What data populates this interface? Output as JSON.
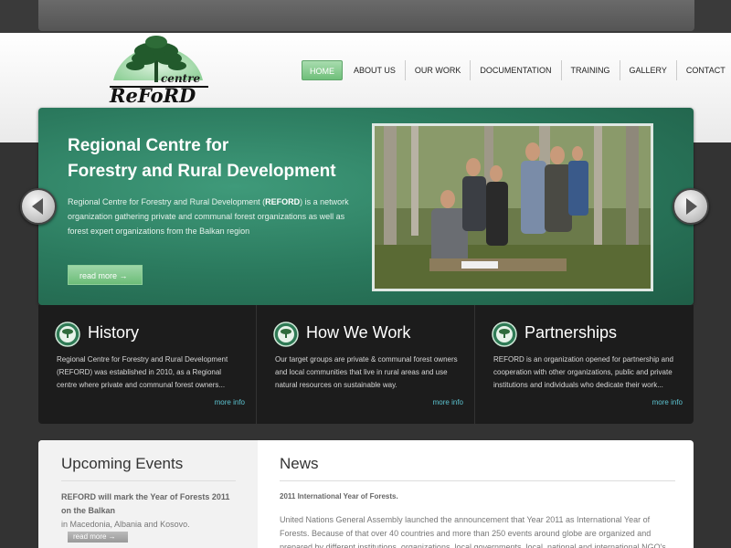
{
  "logo": {
    "word_top": "centre",
    "word_main": "ReFoRD"
  },
  "nav": {
    "items": [
      {
        "label": "HOME",
        "active": true
      },
      {
        "label": "ABOUT US",
        "active": false
      },
      {
        "label": "OUR WORK",
        "active": false
      },
      {
        "label": "DOCUMENTATION",
        "active": false
      },
      {
        "label": "TRAINING",
        "active": false
      },
      {
        "label": "GALLERY",
        "active": false
      },
      {
        "label": "CONTACT",
        "active": false
      }
    ]
  },
  "hero": {
    "title_line1": "Regional Centre for",
    "title_line2": "Forestry and Rural Development",
    "text_part1": "Regional Centre for Forestry and Rural Development (",
    "text_bold": "REFORD",
    "text_part2": ") is a network organization gathering private and communal forest organizations as well as forest expert organizations from the Balkan region",
    "button_label": "read more →"
  },
  "panels": [
    {
      "title": "History",
      "text": "Regional Centre for Forestry and Rural Development (REFORD) was established in 2010, as a Regional centre where private and communal forest owners...",
      "more": "more info"
    },
    {
      "title": "How We Work",
      "text": "Our target groups are private & communal forest owners and local communities that live in rural areas and use natural resources on sustainable way.",
      "more": "more info"
    },
    {
      "title": "Partnerships",
      "text": "REFORD is an organization opened for partnership and cooperation with other organizations, public and private institutions and individuals who dedicate their work...",
      "more": "more info"
    }
  ],
  "events": {
    "heading": "Upcoming Events",
    "item_title": "REFORD will mark the Year of Forests 2011 on the Balkan",
    "item_text": "in Macedonia, Albania and Kosovo.",
    "button_label": "read more →"
  },
  "news": {
    "heading": "News",
    "item_title": "2011 International Year of Forests.",
    "item_text": "United Nations General Assembly launched the announcement that Year 2011 as International Year of Forests. Because of that over 40 countries and more than 250 events around globe are organized and prepared by different institutions, organizations, local governments, local, national and international NGO's."
  },
  "colors": {
    "accent_green": "#6fbf7a",
    "hero_green": "#2b7a5e",
    "link_cyan": "#5cc3d0"
  }
}
